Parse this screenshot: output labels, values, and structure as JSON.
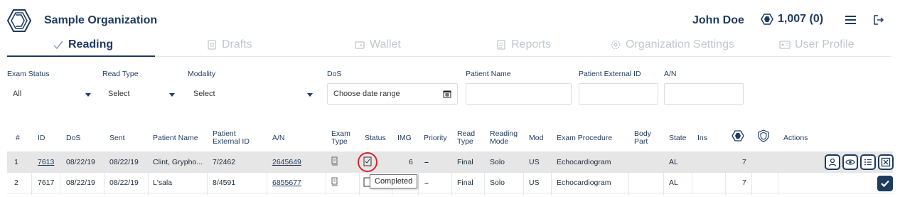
{
  "header": {
    "org_name": "Sample Organization",
    "user_name": "John Doe",
    "credits": "1,007 (0)",
    "logo_icon": "organization-logo-icon",
    "credits_icon": "credits-icon",
    "menu_icon": "hamburger-menu-icon",
    "logout_icon": "logout-icon"
  },
  "tabs": [
    {
      "label": "Reading",
      "icon": "check-icon",
      "active": true
    },
    {
      "label": "Drafts",
      "icon": "drafts-icon",
      "active": false
    },
    {
      "label": "Wallet",
      "icon": "wallet-icon",
      "active": false
    },
    {
      "label": "Reports",
      "icon": "reports-icon",
      "active": false
    },
    {
      "label": "Organization Settings",
      "icon": "gear-icon",
      "active": false
    },
    {
      "label": "User Profile",
      "icon": "id-card-icon",
      "active": false
    }
  ],
  "filters": {
    "exam_status": {
      "label": "Exam Status",
      "value": "All"
    },
    "read_type": {
      "label": "Read Type",
      "value": "Select"
    },
    "modality": {
      "label": "Modality",
      "value": "Select"
    },
    "dos": {
      "label": "DoS",
      "placeholder": "Choose date range"
    },
    "patient_name": {
      "label": "Patient Name",
      "value": ""
    },
    "patient_external_id": {
      "label": "Patient External ID",
      "value": ""
    },
    "an": {
      "label": "A/N",
      "value": ""
    }
  },
  "table": {
    "headers": {
      "num": "#",
      "id": "ID",
      "dos": "DoS",
      "sent": "Sent",
      "patient_name": "Patient Name",
      "patient_external_id_1": "Patient",
      "patient_external_id_2": "External ID",
      "an": "A/N",
      "exam_type_1": "Exam",
      "exam_type_2": "Type",
      "status": "Status",
      "img": "IMG",
      "priority": "Priority",
      "read_type_1": "Read",
      "read_type_2": "Type",
      "reading_mode_1": "Reading",
      "reading_mode_2": "Mode",
      "mod": "Mod",
      "exam_procedure": "Exam Procedure",
      "body_part_1": "Body",
      "body_part_2": "Part",
      "state": "State",
      "ins": "Ins",
      "actions": "Actions"
    },
    "rows": [
      {
        "num": "1",
        "id": "7613",
        "dos": "08/22/19",
        "sent": "08/22/19",
        "patient_name": "Clint, Grypho...",
        "patient_external_id": "7/2462",
        "an": "2645649",
        "img": "6",
        "priority": "–",
        "read_type": "Final",
        "reading_mode": "Solo",
        "mod": "US",
        "exam_procedure": "Echocardiogram",
        "body_part": "",
        "state": "AL",
        "ins": "",
        "count": "7"
      },
      {
        "num": "2",
        "id": "7617",
        "dos": "08/22/19",
        "sent": "08/22/19",
        "patient_name": "L'sala",
        "patient_external_id": "8/4591",
        "an": "6855677",
        "img": "",
        "priority": "–",
        "read_type": "Final",
        "reading_mode": "Solo",
        "mod": "US",
        "exam_procedure": "Echocardiogram",
        "body_part": "",
        "state": "AL",
        "ins": "",
        "count": "7"
      }
    ]
  },
  "tooltip": "Completed",
  "colors": {
    "primary": "#1e3a5f",
    "highlight": "#d9262b",
    "inactive": "#c2c7ce"
  }
}
